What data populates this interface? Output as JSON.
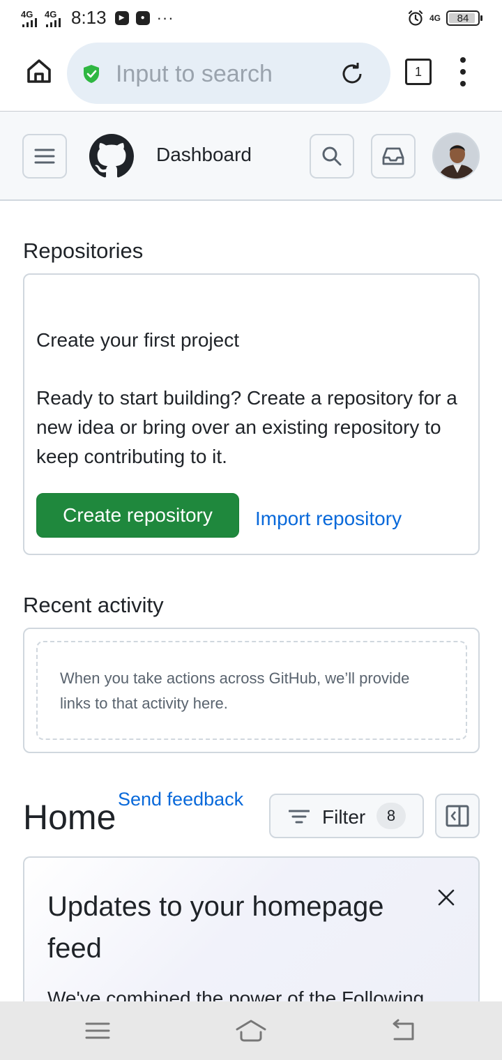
{
  "status_bar": {
    "network1": "4G",
    "network2": "4G",
    "time": "8:13",
    "more": "···",
    "network3": "4G",
    "battery_level": "84",
    "battery_fraction": 0.84
  },
  "browser": {
    "search_placeholder": "Input to search",
    "tab_count": "1"
  },
  "header": {
    "title": "Dashboard"
  },
  "repositories": {
    "section_title": "Repositories",
    "heading": "Create your first project",
    "description": "Ready to start building? Create a repository for a new idea or bring over an existing repository to keep contributing to it.",
    "create_label": "Create repository",
    "import_label": "Import repository"
  },
  "activity": {
    "section_title": "Recent activity",
    "empty_text": "When you take actions across GitHub, we’ll provide links to that activity here."
  },
  "home": {
    "title": "Home",
    "feedback_link": "Send feedback",
    "filter_label": "Filter",
    "filter_count": "8"
  },
  "updates": {
    "title": "Updates to your homepage feed",
    "body": "We've combined the power of the Following"
  },
  "colors": {
    "primary_button": "#1f883d",
    "link": "#0969da",
    "header_bg": "#f6f8fa",
    "border": "#d0d7de",
    "shield": "#2fb742"
  }
}
